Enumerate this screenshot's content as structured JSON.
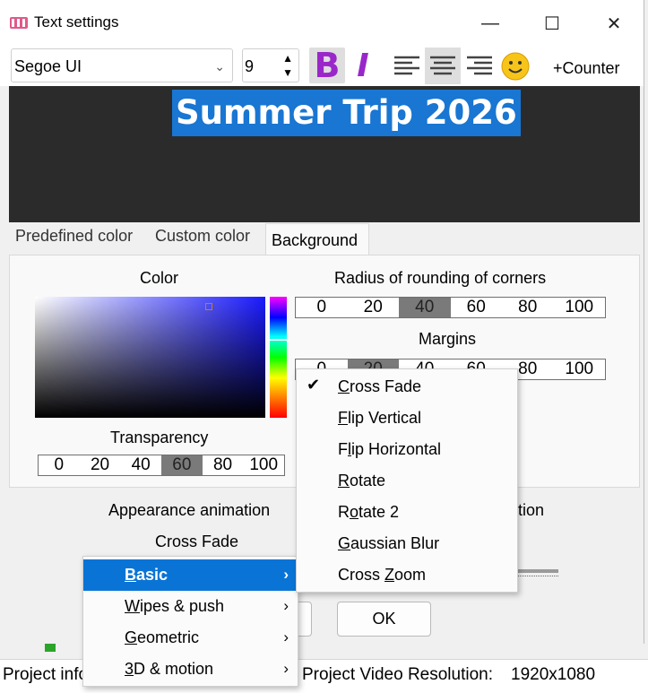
{
  "window": {
    "title": "Text settings",
    "controls": {
      "minimize": "—",
      "maximize": "☐",
      "close": "✕"
    }
  },
  "toolbar": {
    "font": "Segoe UI",
    "size": "9",
    "bold": "B",
    "italic": "I",
    "counter": "+Counter"
  },
  "preview": {
    "text": "Summer Trip 2026"
  },
  "tabs": [
    {
      "label": "Predefined color"
    },
    {
      "label": "Custom color"
    },
    {
      "label": "Background",
      "active": true
    }
  ],
  "background": {
    "color_label": "Color",
    "transparency_label": "Transparency",
    "transparency_scale": [
      "0",
      "20",
      "40",
      "60",
      "80",
      "100"
    ],
    "transparency_selected": "60",
    "radius_label": "Radius of rounding of corners",
    "radius_scale": [
      "0",
      "20",
      "40",
      "60",
      "80",
      "100"
    ],
    "radius_selected": "40",
    "margins_label": "Margins",
    "margins_scale": [
      "0",
      "20",
      "40",
      "60",
      "80",
      "100"
    ],
    "margins_selected": "20"
  },
  "animation": {
    "appearance_label": "Appearance animation",
    "appearance_value": "Cross Fade",
    "disappearance_label_partial": "ation"
  },
  "buttons": {
    "ok": "OK"
  },
  "category_menu": [
    {
      "label": "Basic",
      "ul": "B",
      "rest": "asic",
      "highlighted": true
    },
    {
      "label": "Wipes & push",
      "ul": "W",
      "rest": "ipes & push"
    },
    {
      "label": "Geometric",
      "ul": "G",
      "rest": "eometric"
    },
    {
      "label": "3D & motion",
      "ul": "3",
      "rest": "D & motion"
    }
  ],
  "submenu": [
    {
      "label": "Cross Fade",
      "ul": "C",
      "rest": "ross Fade",
      "checked": true
    },
    {
      "label": "Flip Vertical",
      "ul": "F",
      "rest": "lip Vertical"
    },
    {
      "label": "Flip Horizontal",
      "pre": "F",
      "ul": "l",
      "rest": "ip Horizontal"
    },
    {
      "label": "Rotate",
      "ul": "R",
      "rest": "otate"
    },
    {
      "label": "Rotate 2",
      "pre": "R",
      "ul": "o",
      "rest": "tate 2"
    },
    {
      "label": "Gaussian Blur",
      "ul": "G",
      "rest": "aussian Blur"
    },
    {
      "label": "Cross Zoom",
      "pre": "Cross ",
      "ul": "Z",
      "rest": "oom"
    }
  ],
  "statusbar": {
    "project_info": "Project info",
    "resolution_label": "Project Video Resolution:",
    "resolution_value": "1920x1080"
  },
  "colors": {
    "accent": "#0a74d6",
    "format_buttons": "#9a27c9",
    "preview_bg": "#2b2b2b"
  }
}
